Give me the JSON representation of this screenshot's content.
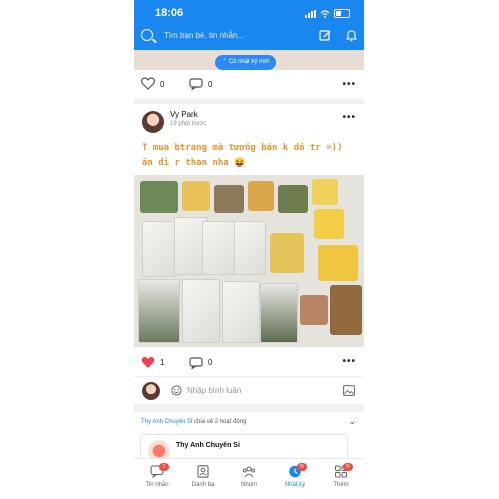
{
  "status_bar": {
    "time": "18:06"
  },
  "search": {
    "placeholder": "Tìm bạn bè, tin nhắn..."
  },
  "new_posts_pill": "Có nhật ký mới",
  "prev_post": {
    "likes": "0",
    "comments": "0"
  },
  "post": {
    "author": "Vy Park",
    "time": "19 phút trước",
    "caption_line1": "T mua btrang mà tưởng bán k dó tr =))",
    "caption_line2": "ăn di r than nha 😝",
    "likes": "1",
    "comments": "0",
    "comment_placeholder": "Nhập bình luận"
  },
  "share": {
    "user": "Thy Anh Chuyên Sỉ",
    "text": " chia sẻ 2 hoạt động",
    "card_name": "Thy Anh Chuyên Sỉ"
  },
  "nav": [
    {
      "label": "Tin nhắn",
      "badge": "2"
    },
    {
      "label": "Danh bạ",
      "badge": ""
    },
    {
      "label": "Nhóm",
      "badge": ""
    },
    {
      "label": "Nhật ký",
      "badge": "N"
    },
    {
      "label": "Thêm",
      "badge": "N"
    }
  ],
  "colors": {
    "brand": "#1a86f0",
    "caption": "#e8922c",
    "like": "#e8414f",
    "badge": "#f24b3e"
  }
}
